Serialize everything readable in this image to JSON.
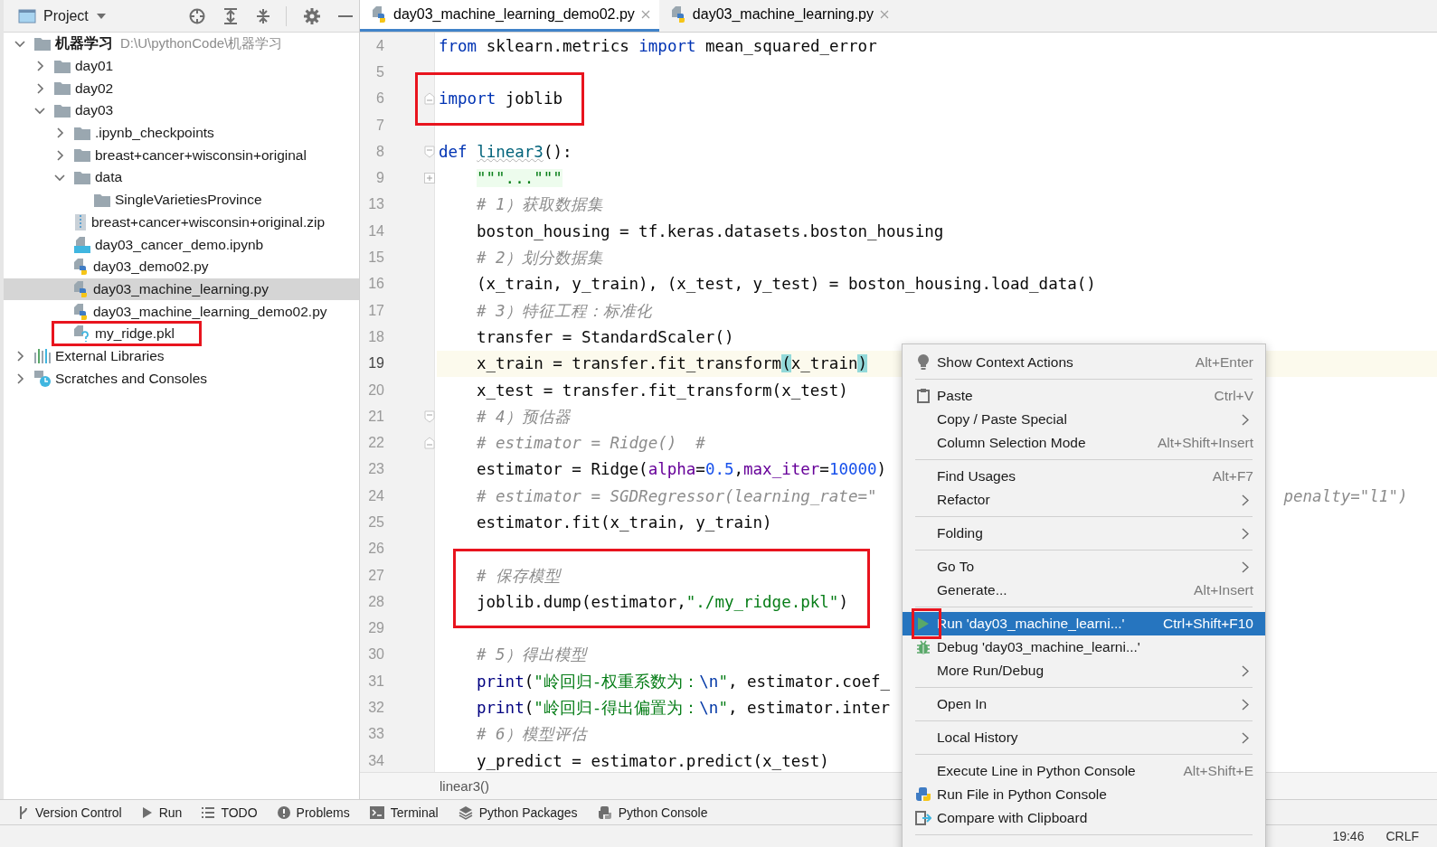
{
  "project_panel": {
    "title": "Project",
    "tree": [
      {
        "kind": "root",
        "label": "机器学习",
        "path": "D:\\U\\pythonCode\\机器学习",
        "expanded": true,
        "selected": false,
        "highlighted": false,
        "children": [
          {
            "kind": "folder",
            "label": "day01",
            "expanded": false,
            "selected": false,
            "highlighted": false
          },
          {
            "kind": "folder",
            "label": "day02",
            "expanded": false,
            "selected": false,
            "highlighted": false
          },
          {
            "kind": "folder",
            "label": "day03",
            "expanded": true,
            "selected": false,
            "highlighted": false,
            "children": [
              {
                "kind": "folder",
                "label": ".ipynb_checkpoints",
                "expanded": false,
                "selected": false,
                "highlighted": false
              },
              {
                "kind": "folder",
                "label": "breast+cancer+wisconsin+original",
                "expanded": false,
                "selected": false,
                "highlighted": false
              },
              {
                "kind": "folder",
                "label": "data",
                "expanded": true,
                "selected": false,
                "highlighted": false,
                "children": [
                  {
                    "kind": "folder",
                    "label": "SingleVarietiesProvince",
                    "selected": false,
                    "highlighted": false
                  }
                ]
              },
              {
                "kind": "zip",
                "label": "breast+cancer+wisconsin+original.zip",
                "selected": false,
                "highlighted": false
              },
              {
                "kind": "notebook",
                "label": "day03_cancer_demo.ipynb",
                "selected": false,
                "highlighted": false
              },
              {
                "kind": "python",
                "label": "day03_demo02.py",
                "selected": false,
                "highlighted": false
              },
              {
                "kind": "python",
                "label": "day03_machine_learning.py",
                "selected": true,
                "highlighted": false
              },
              {
                "kind": "python",
                "label": "day03_machine_learning_demo02.py",
                "selected": false,
                "highlighted": false
              },
              {
                "kind": "unknown",
                "label": "my_ridge.pkl",
                "selected": false,
                "highlighted": true
              }
            ]
          }
        ]
      },
      {
        "kind": "libraries",
        "label": "External Libraries",
        "expanded": false,
        "selected": false,
        "highlighted": false
      },
      {
        "kind": "scratches",
        "label": "Scratches and Consoles",
        "expanded": false,
        "selected": false,
        "highlighted": false
      }
    ]
  },
  "editor": {
    "tabs": [
      {
        "label": "day03_machine_learning_demo02.py",
        "selected": true
      },
      {
        "label": "day03_machine_learning.py",
        "selected": false
      }
    ],
    "lines": [
      {
        "number": "4",
        "indented": false,
        "current": false,
        "highlighted": false,
        "segments": [
          {
            "kind": "kw",
            "text": "from"
          },
          {
            "kind": "plain",
            "text": " sklearn.metrics "
          },
          {
            "kind": "kw",
            "text": "import"
          },
          {
            "kind": "plain",
            "text": " mean_squared_error"
          }
        ]
      },
      {
        "number": "5",
        "current": false,
        "highlighted": false
      },
      {
        "number": "6",
        "indented": false,
        "current": false,
        "highlighted": true,
        "fold": {
          "kind": "end"
        },
        "segments": [
          {
            "kind": "kw",
            "text": "import"
          },
          {
            "kind": "plain",
            "text": " joblib"
          }
        ]
      },
      {
        "number": "7",
        "current": false,
        "highlighted": false
      },
      {
        "number": "8",
        "indented": false,
        "current": false,
        "highlighted": false,
        "fold": {
          "kind": "start"
        },
        "segments": [
          {
            "kind": "kw",
            "text": "def "
          },
          {
            "kind": "func",
            "text": "linear3"
          },
          {
            "kind": "plain",
            "text": "():"
          }
        ]
      },
      {
        "number": "9",
        "indented": true,
        "current": false,
        "highlighted": false,
        "fold": {
          "kind": "collapsed"
        },
        "segments": [
          {
            "kind": "doc",
            "text": "\"\"\"...\"\"\""
          }
        ]
      },
      {
        "number": "13",
        "indented": true,
        "current": false,
        "highlighted": false,
        "segments": [
          {
            "kind": "comment",
            "text": "# 1）获取数据集"
          }
        ]
      },
      {
        "number": "14",
        "indented": true,
        "current": false,
        "highlighted": false,
        "segments": [
          {
            "kind": "plain",
            "text": "boston_housing = tf.keras.datasets.boston_housing"
          }
        ]
      },
      {
        "number": "15",
        "indented": true,
        "current": false,
        "highlighted": false,
        "segments": [
          {
            "kind": "comment",
            "text": "# 2）划分数据集"
          }
        ]
      },
      {
        "number": "16",
        "indented": true,
        "current": false,
        "highlighted": false,
        "segments": [
          {
            "kind": "plain",
            "text": "(x_train, y_train), (x_test, y_test) = boston_housing.load_data()"
          }
        ]
      },
      {
        "number": "17",
        "indented": true,
        "current": false,
        "highlighted": false,
        "segments": [
          {
            "kind": "comment",
            "text": "# 3）特征工程：标准化"
          }
        ]
      },
      {
        "number": "18",
        "indented": true,
        "current": false,
        "highlighted": false,
        "segments": [
          {
            "kind": "plain",
            "text": "transfer = StandardScaler()"
          }
        ]
      },
      {
        "number": "19",
        "indented": true,
        "current": true,
        "highlighted": false,
        "segments": [
          {
            "kind": "plain",
            "text": "x_train = transfer.fit_transform"
          },
          {
            "kind": "match",
            "text": "("
          },
          {
            "kind": "plain",
            "text": "x_train"
          },
          {
            "kind": "match",
            "text": ")"
          }
        ]
      },
      {
        "number": "20",
        "indented": true,
        "current": false,
        "highlighted": false,
        "segments": [
          {
            "kind": "plain",
            "text": "x_test = transfer.fit_transform(x_test)"
          }
        ]
      },
      {
        "number": "21",
        "indented": true,
        "current": false,
        "highlighted": false,
        "fold": {
          "kind": "start"
        },
        "segments": [
          {
            "kind": "comment",
            "text": "# 4）预估器"
          }
        ]
      },
      {
        "number": "22",
        "indented": true,
        "current": false,
        "highlighted": false,
        "fold": {
          "kind": "end"
        },
        "segments": [
          {
            "kind": "comment",
            "text": "# estimator = Ridge()  #"
          }
        ]
      },
      {
        "number": "23",
        "indented": true,
        "current": false,
        "highlighted": false,
        "segments": [
          {
            "kind": "plain",
            "text": "estimator = Ridge("
          },
          {
            "kind": "param",
            "text": "alpha"
          },
          {
            "kind": "plain",
            "text": "="
          },
          {
            "kind": "number",
            "text": "0.5"
          },
          {
            "kind": "plain",
            "text": ","
          },
          {
            "kind": "param",
            "text": "max_iter"
          },
          {
            "kind": "plain",
            "text": "="
          },
          {
            "kind": "number",
            "text": "10000"
          },
          {
            "kind": "plain",
            "text": ")"
          }
        ]
      },
      {
        "number": "24",
        "indented": true,
        "current": false,
        "highlighted": false,
        "segments": [
          {
            "kind": "comment",
            "text": "# estimator = SGDRegressor(learning_rate=\""
          }
        ],
        "continuation": {
          "kind": "comment",
          "text": "penalty=\"l1\")"
        }
      },
      {
        "number": "25",
        "indented": true,
        "current": false,
        "highlighted": false,
        "segments": [
          {
            "kind": "plain",
            "text": "estimator.fit(x_train, y_train)"
          }
        ]
      },
      {
        "number": "26",
        "current": false,
        "highlighted": false
      },
      {
        "number": "27",
        "indented": true,
        "current": false,
        "highlighted": true,
        "segments": [
          {
            "kind": "comment",
            "text": "# 保存模型"
          }
        ]
      },
      {
        "number": "28",
        "indented": true,
        "current": false,
        "highlighted": true,
        "segments": [
          {
            "kind": "plain",
            "text": "joblib.dump(estimator,"
          },
          {
            "kind": "string",
            "text": "\"./my_ridge.pkl\""
          },
          {
            "kind": "plain",
            "text": ")"
          }
        ]
      },
      {
        "number": "29",
        "current": false,
        "highlighted": false
      },
      {
        "number": "30",
        "indented": true,
        "current": false,
        "highlighted": false,
        "segments": [
          {
            "kind": "comment",
            "text": "# 5）得出模型"
          }
        ]
      },
      {
        "number": "31",
        "indented": true,
        "current": false,
        "highlighted": false,
        "segments": [
          {
            "kind": "builtin",
            "text": "print"
          },
          {
            "kind": "plain",
            "text": "("
          },
          {
            "kind": "string",
            "text": "\"岭回归-权重系数为："
          },
          {
            "kind": "escape",
            "text": "\\n"
          },
          {
            "kind": "string",
            "text": "\""
          },
          {
            "kind": "plain",
            "text": ", estimator.coef_"
          }
        ]
      },
      {
        "number": "32",
        "indented": true,
        "current": false,
        "highlighted": false,
        "segments": [
          {
            "kind": "builtin",
            "text": "print"
          },
          {
            "kind": "plain",
            "text": "("
          },
          {
            "kind": "string",
            "text": "\"岭回归-得出偏置为："
          },
          {
            "kind": "escape",
            "text": "\\n"
          },
          {
            "kind": "string",
            "text": "\""
          },
          {
            "kind": "plain",
            "text": ", estimator.inter"
          }
        ]
      },
      {
        "number": "33",
        "indented": true,
        "current": false,
        "highlighted": false,
        "segments": [
          {
            "kind": "comment",
            "text": "# 6）模型评估"
          }
        ]
      },
      {
        "number": "34",
        "indented": true,
        "current": false,
        "highlighted": false,
        "segments": [
          {
            "kind": "plain",
            "text": "y_predict = estimator.predict(x_test)"
          }
        ]
      }
    ],
    "breadcrumb": "linear3()"
  },
  "context_menu": {
    "items": [
      {
        "kind": "context-actions",
        "label": "Show Context Actions",
        "shortcut": "Alt+Enter",
        "submenu": false,
        "selected": false,
        "icon_highlighted": false
      },
      {
        "kind": "separator"
      },
      {
        "kind": "paste",
        "label": "Paste",
        "shortcut": "Ctrl+V",
        "submenu": false,
        "selected": false,
        "icon_highlighted": false
      },
      {
        "kind": "plain",
        "label": "Copy / Paste Special",
        "submenu": true,
        "selected": false,
        "icon_highlighted": false
      },
      {
        "kind": "plain",
        "label": "Column Selection Mode",
        "shortcut": "Alt+Shift+Insert",
        "submenu": false,
        "selected": false,
        "icon_highlighted": false
      },
      {
        "kind": "separator"
      },
      {
        "kind": "plain",
        "label": "Find Usages",
        "shortcut": "Alt+F7",
        "submenu": false,
        "selected": false,
        "icon_highlighted": false
      },
      {
        "kind": "plain",
        "label": "Refactor",
        "submenu": true,
        "selected": false,
        "icon_highlighted": false
      },
      {
        "kind": "separator"
      },
      {
        "kind": "plain",
        "label": "Folding",
        "submenu": true,
        "selected": false,
        "icon_highlighted": false
      },
      {
        "kind": "separator"
      },
      {
        "kind": "plain",
        "label": "Go To",
        "submenu": true,
        "selected": false,
        "icon_highlighted": false
      },
      {
        "kind": "plain",
        "label": "Generate...",
        "shortcut": "Alt+Insert",
        "submenu": false,
        "selected": false,
        "icon_highlighted": false
      },
      {
        "kind": "separator"
      },
      {
        "kind": "run",
        "label": "Run 'day03_machine_learni...'",
        "shortcut": "Ctrl+Shift+F10",
        "submenu": false,
        "selected": true,
        "icon_highlighted": true
      },
      {
        "kind": "debug",
        "label": "Debug 'day03_machine_learni...'",
        "submenu": false,
        "selected": false,
        "icon_highlighted": false
      },
      {
        "kind": "plain",
        "label": "More Run/Debug",
        "submenu": true,
        "selected": false,
        "icon_highlighted": false
      },
      {
        "kind": "separator"
      },
      {
        "kind": "plain",
        "label": "Open In",
        "submenu": true,
        "selected": false,
        "icon_highlighted": false
      },
      {
        "kind": "separator"
      },
      {
        "kind": "plain",
        "label": "Local History",
        "submenu": true,
        "selected": false,
        "icon_highlighted": false
      },
      {
        "kind": "separator"
      },
      {
        "kind": "plain",
        "label": "Execute Line in Python Console",
        "shortcut": "Alt+Shift+E",
        "submenu": false,
        "selected": false,
        "icon_highlighted": false
      },
      {
        "kind": "python-console",
        "label": "Run File in Python Console",
        "submenu": false,
        "selected": false,
        "icon_highlighted": false
      },
      {
        "kind": "compare",
        "label": "Compare with Clipboard",
        "submenu": false,
        "selected": false,
        "icon_highlighted": false
      },
      {
        "kind": "separator"
      }
    ]
  },
  "tool_window_bar": [
    {
      "kind": "vcs",
      "label": "Version Control"
    },
    {
      "kind": "run",
      "label": "Run"
    },
    {
      "kind": "todo",
      "label": "TODO"
    },
    {
      "kind": "problems",
      "label": "Problems"
    },
    {
      "kind": "terminal",
      "label": "Terminal"
    },
    {
      "kind": "packages",
      "label": "Python Packages"
    },
    {
      "kind": "console",
      "label": "Python Console"
    }
  ],
  "status_bar": [
    "19:46",
    "CRLF"
  ]
}
